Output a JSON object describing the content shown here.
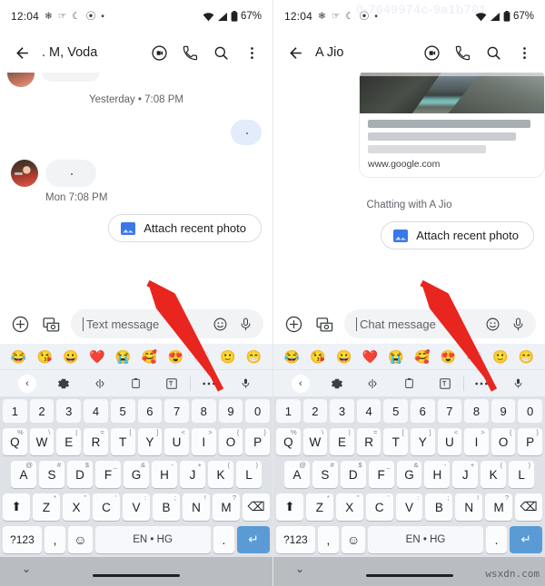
{
  "meta": {
    "watermark": "wsxdn.com",
    "ghost_watermark": "0-7049974c-9a1b701"
  },
  "status_bar": {
    "time": "12:04",
    "battery_percent": "67%",
    "icons": [
      "clover-icon",
      "hand-icon",
      "crescent-icon",
      "swirl-icon",
      "dot-icon"
    ],
    "right_icons": [
      "wifi-icon",
      "signal-icon",
      "battery-icon"
    ]
  },
  "panels": [
    {
      "id": "left",
      "app_bar": {
        "back": "back-arrow",
        "title": ". M, Voda",
        "actions": [
          "video-call-icon",
          "phone-icon",
          "search-icon",
          "overflow-menu-icon"
        ]
      },
      "conversation": {
        "daystamp": "Yesterday • 7:08 PM",
        "timestamp": "Mon 7:08 PM",
        "has_link_card": false,
        "chatting_with": "",
        "chip_label": "Attach recent photo"
      },
      "composer": {
        "placeholder": "Text message",
        "left_icons": [
          "plus-circle-icon",
          "gallery-camera-icon"
        ],
        "right_icons": [
          "emoji-icon",
          "mic-icon"
        ]
      }
    },
    {
      "id": "right",
      "app_bar": {
        "back": "back-arrow",
        "title": "A Jio",
        "actions": [
          "video-call-icon",
          "phone-icon",
          "search-icon",
          "overflow-menu-icon"
        ]
      },
      "conversation": {
        "daystamp": "",
        "timestamp": "",
        "has_link_card": true,
        "link_card_url": "www.google.com",
        "chatting_with": "Chatting with A Jio",
        "chip_label": "Attach recent photo"
      },
      "composer": {
        "placeholder": "Chat message",
        "left_icons": [
          "plus-circle-icon",
          "gallery-camera-icon"
        ],
        "right_icons": [
          "emoji-icon",
          "mic-icon"
        ]
      }
    }
  ],
  "keyboard": {
    "emoji_strip": [
      "😂",
      "😘",
      "😀",
      "❤️",
      "😭",
      "🥰",
      "😍",
      "👀",
      "🙂",
      "😁"
    ],
    "toolbar": [
      "chevron-left-icon",
      "gear-icon",
      "text-cursor-icon",
      "clipboard-icon",
      "translate-icon",
      "more-icon",
      "mic-icon"
    ],
    "number_row": [
      "1",
      "2",
      "3",
      "4",
      "5",
      "6",
      "7",
      "8",
      "9",
      "0"
    ],
    "row1": [
      {
        "k": "Q",
        "s": "%"
      },
      {
        "k": "W",
        "s": "\\"
      },
      {
        "k": "E",
        "s": "|"
      },
      {
        "k": "R",
        "s": "="
      },
      {
        "k": "T",
        "s": "["
      },
      {
        "k": "Y",
        "s": "]"
      },
      {
        "k": "U",
        "s": "<"
      },
      {
        "k": "I",
        "s": ">"
      },
      {
        "k": "O",
        "s": "{"
      },
      {
        "k": "P",
        "s": "}"
      }
    ],
    "row2": [
      {
        "k": "A",
        "s": "@"
      },
      {
        "k": "S",
        "s": "#"
      },
      {
        "k": "D",
        "s": "$"
      },
      {
        "k": "F",
        "s": "_"
      },
      {
        "k": "G",
        "s": "&"
      },
      {
        "k": "H",
        "s": "-"
      },
      {
        "k": "J",
        "s": "+"
      },
      {
        "k": "K",
        "s": "("
      },
      {
        "k": "L",
        "s": ")"
      }
    ],
    "row3": [
      {
        "k": "⬆",
        "s": ""
      },
      {
        "k": "Z",
        "s": "*"
      },
      {
        "k": "X",
        "s": "\""
      },
      {
        "k": "C",
        "s": "'"
      },
      {
        "k": "V",
        "s": ":"
      },
      {
        "k": "B",
        "s": ";"
      },
      {
        "k": "N",
        "s": "!"
      },
      {
        "k": "M",
        "s": "?"
      },
      {
        "k": "⌫",
        "s": ""
      }
    ],
    "row4": {
      "symbols": "?123",
      "comma": ",",
      "emoji": "☺",
      "space": "EN • HG",
      "period": ".",
      "enter": "↵"
    },
    "enter_color": "#5b9bd5"
  }
}
